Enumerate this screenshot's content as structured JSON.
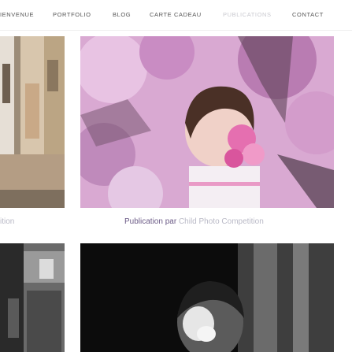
{
  "nav": {
    "items": [
      {
        "label": "IENVENUE",
        "active": false
      },
      {
        "label": "PORTFOLIO",
        "active": false
      },
      {
        "label": "BLOG",
        "active": false
      },
      {
        "label": "CARTE CADEAU",
        "active": false
      },
      {
        "label": "PUBLICATIONS",
        "active": true
      },
      {
        "label": "CONTACT",
        "active": false
      }
    ]
  },
  "captions": {
    "left_fragment": "ition",
    "publication_prefix": "Publication par",
    "publication_link": "Child Photo Competition"
  },
  "colors": {
    "nav_text": "#555555",
    "nav_active_text": "#c9c9cf",
    "caption_prefix": "#6b5a86",
    "caption_link": "#b9b9c6"
  }
}
